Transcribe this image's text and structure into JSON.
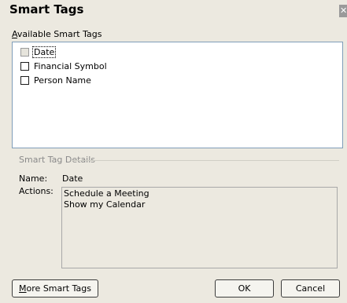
{
  "dialog": {
    "title": "Smart Tags",
    "close_glyph": "✕"
  },
  "available": {
    "label_accel": "A",
    "label_rest": "vailable Smart Tags",
    "items": [
      {
        "label": "Date",
        "checked": false,
        "selected": true,
        "disabled": true
      },
      {
        "label": "Financial Symbol",
        "checked": false,
        "selected": false,
        "disabled": false
      },
      {
        "label": "Person Name",
        "checked": false,
        "selected": false,
        "disabled": false
      }
    ]
  },
  "details": {
    "legend": "Smart Tag Details",
    "name_label": "Name:",
    "name_value": "Date",
    "actions_label": "Actions:",
    "actions": [
      "Schedule a Meeting",
      "Show my Calendar"
    ]
  },
  "buttons": {
    "more_accel": "M",
    "more_rest": "ore Smart Tags",
    "ok": "OK",
    "cancel": "Cancel"
  }
}
